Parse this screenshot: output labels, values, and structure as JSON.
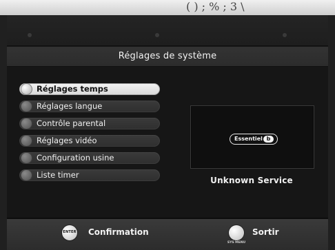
{
  "photo": {
    "scribble": "( ) ; % ; 3 \\"
  },
  "header": {
    "title": "Réglages de système"
  },
  "menu": {
    "items": [
      {
        "label": "Réglages temps",
        "icon": "clock-icon",
        "selected": true
      },
      {
        "label": "Réglages langue",
        "icon": "language-icon",
        "selected": false
      },
      {
        "label": "Contrôle parental",
        "icon": "parental-lock-icon",
        "selected": false
      },
      {
        "label": "Réglages vidéo",
        "icon": "video-icon",
        "selected": false
      },
      {
        "label": "Configuration usine",
        "icon": "factory-reset-icon",
        "selected": false
      },
      {
        "label": "Liste timer",
        "icon": "timer-list-icon",
        "selected": false
      }
    ]
  },
  "preview": {
    "brand_text": "Essentiel",
    "brand_badge": "b",
    "service_label": "Unknown Service"
  },
  "footer": {
    "enter_key": "ENTER",
    "confirm_label": "Confirmation",
    "sys_menu_key": "SYS MENU",
    "exit_label": "Sortir"
  }
}
